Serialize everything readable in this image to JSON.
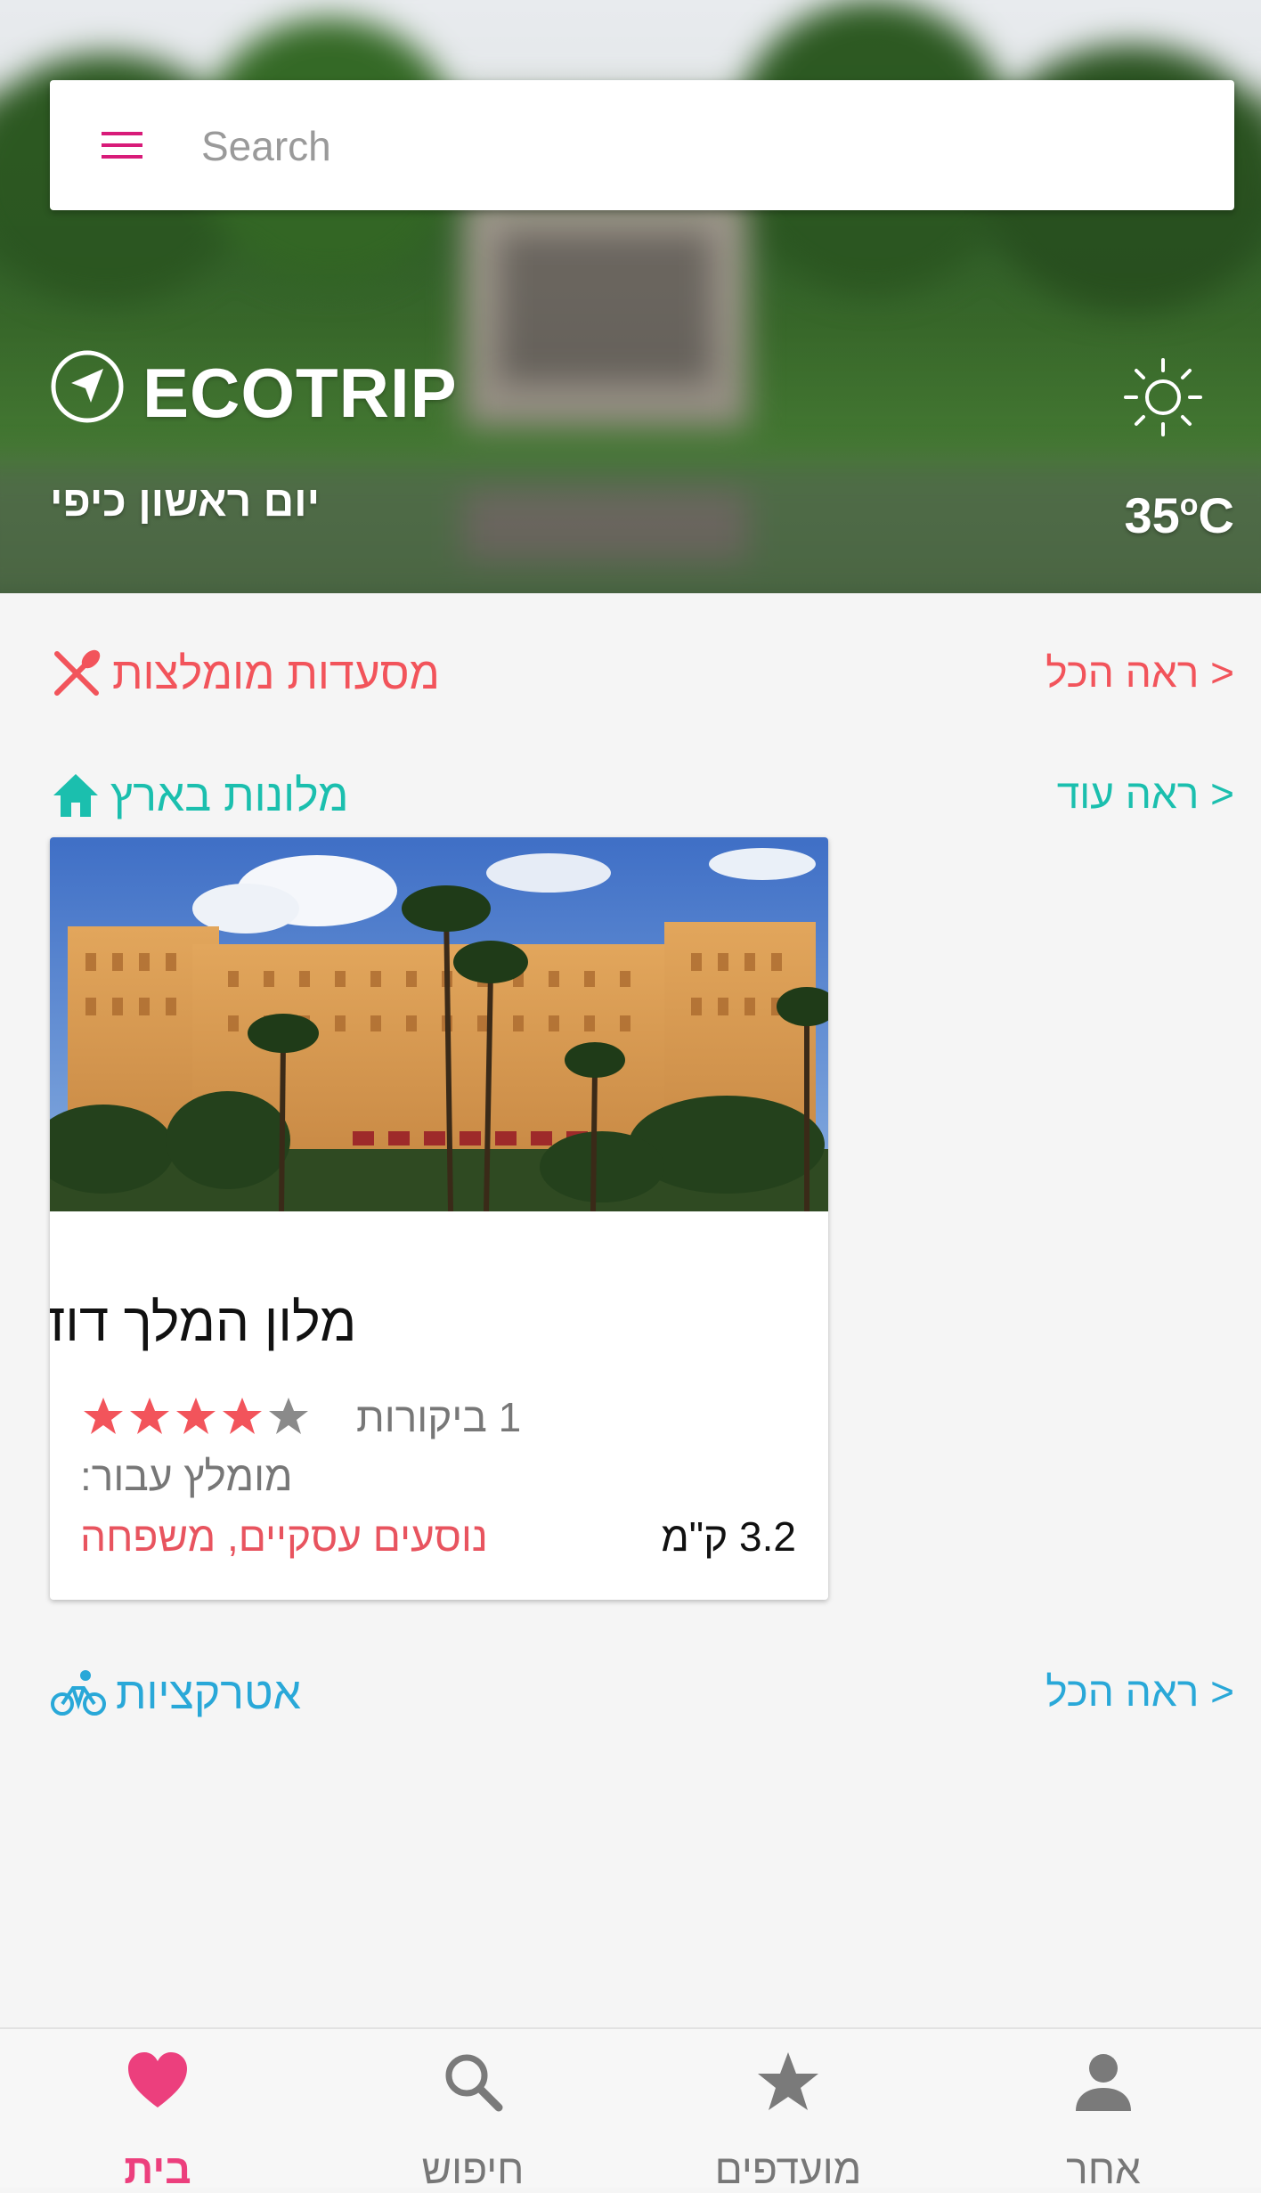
{
  "search": {
    "placeholder": "Search"
  },
  "hero": {
    "brand": "ECOTRIP",
    "greeting": "יום ראשון כיפי",
    "temperature_value": "35",
    "temperature_unit_degree": "o",
    "temperature_unit": "C",
    "weather_icon": "sun-icon",
    "logo_icon": "navigation-arrow-icon"
  },
  "sections": {
    "restaurants": {
      "title": "מסעדות מומלצות",
      "link": "< ראה הכל",
      "icon": "fork-knife-icon",
      "color": "#f2545b"
    },
    "hotels": {
      "title": "מלונות בארץ",
      "link": "< ראה עוד",
      "icon": "home-icon",
      "color": "#1bbfae"
    },
    "attractions": {
      "title": "אטרקציות",
      "link": "< ראה הכל",
      "icon": "bicycle-icon",
      "color": "#29a8d8"
    }
  },
  "hotel_card": {
    "name": "מלון המלך דוד",
    "rating": 4,
    "rating_max": 5,
    "reviews": "1 ביקורות",
    "recommended_label": "מומלץ עבור:",
    "recommended_for": "נוסעים עסקיים, משפחה",
    "distance": "3.2 ק\"מ",
    "star_color": "#f2545b"
  },
  "bottom_nav": {
    "items": [
      {
        "label": "בית",
        "icon": "heart-icon",
        "active": true
      },
      {
        "label": "חיפוש",
        "icon": "search-icon",
        "active": false
      },
      {
        "label": "מועדפים",
        "icon": "star-icon",
        "active": false
      },
      {
        "label": "אחר",
        "icon": "person-icon",
        "active": false
      }
    ],
    "active_color": "#ec3f7d"
  }
}
